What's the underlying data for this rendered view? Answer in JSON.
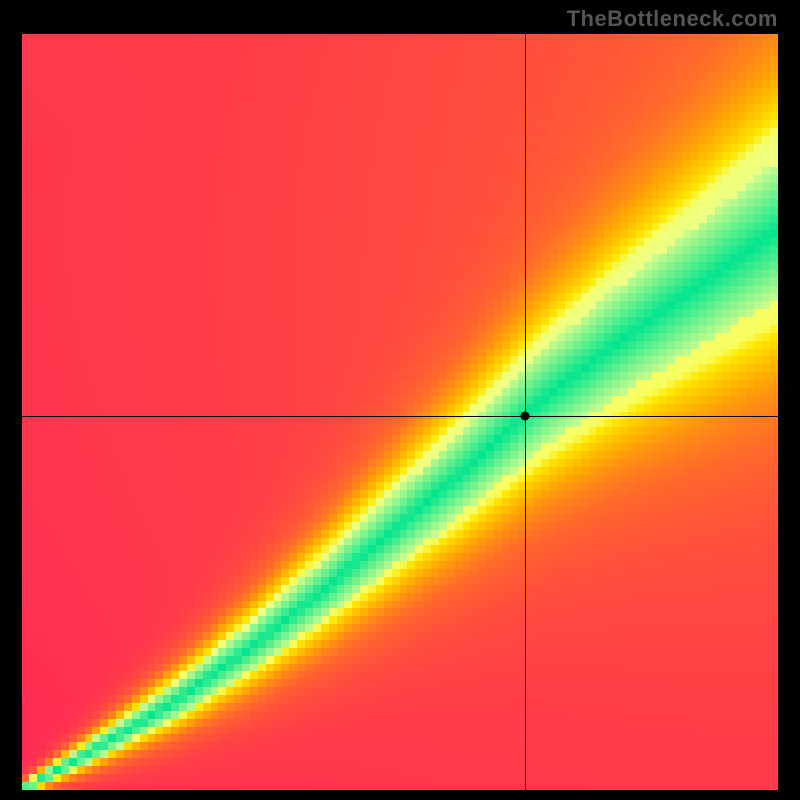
{
  "watermark": "TheBottleneck.com",
  "chart_data": {
    "type": "heatmap",
    "title": "",
    "xlabel": "",
    "ylabel": "",
    "xlim": [
      0,
      1
    ],
    "ylim": [
      0,
      1
    ],
    "grid": false,
    "legend": false,
    "crosshair": {
      "x": 0.665,
      "y": 0.495
    },
    "marker": {
      "x": 0.665,
      "y": 0.495
    },
    "ridge": {
      "description": "green ridge curve from (0,0) to (1,~0.74); widening toward top-right",
      "points": [
        {
          "x": 0.0,
          "y": 0.0
        },
        {
          "x": 0.1,
          "y": 0.055
        },
        {
          "x": 0.2,
          "y": 0.115
        },
        {
          "x": 0.3,
          "y": 0.185
        },
        {
          "x": 0.4,
          "y": 0.265
        },
        {
          "x": 0.5,
          "y": 0.35
        },
        {
          "x": 0.6,
          "y": 0.435
        },
        {
          "x": 0.665,
          "y": 0.495
        },
        {
          "x": 0.7,
          "y": 0.525
        },
        {
          "x": 0.8,
          "y": 0.6
        },
        {
          "x": 0.9,
          "y": 0.67
        },
        {
          "x": 1.0,
          "y": 0.74
        }
      ],
      "width_start": 0.01,
      "width_end": 0.18
    },
    "color_stops": [
      {
        "t": 0.0,
        "color": "#ff2a55"
      },
      {
        "t": 0.3,
        "color": "#ff6a2a"
      },
      {
        "t": 0.55,
        "color": "#ffb000"
      },
      {
        "t": 0.78,
        "color": "#ffe700"
      },
      {
        "t": 0.9,
        "color": "#f7ff66"
      },
      {
        "t": 0.965,
        "color": "#e9ff8c"
      },
      {
        "t": 1.0,
        "color": "#00e58f"
      }
    ],
    "resolution": 96
  }
}
